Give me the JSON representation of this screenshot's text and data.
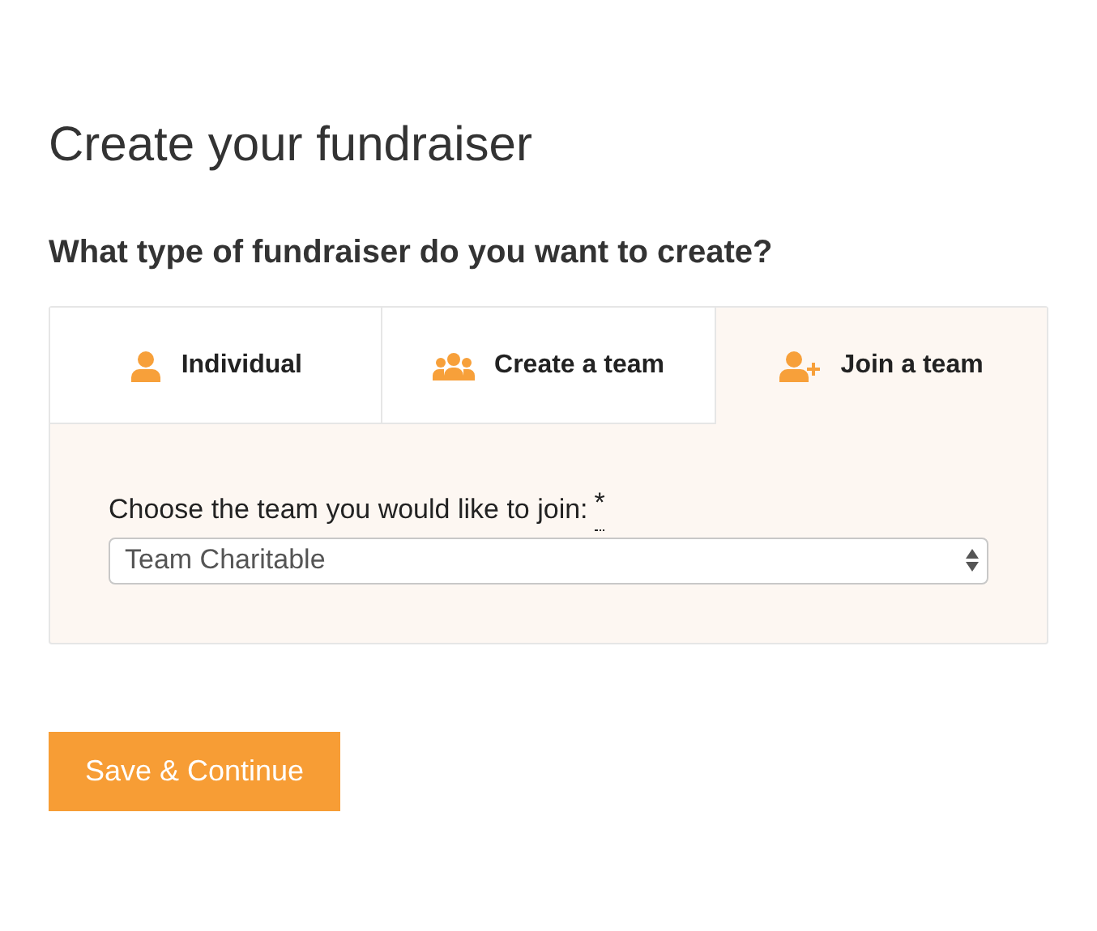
{
  "page_title": "Create your fundraiser",
  "question": "What type of fundraiser do you want to create?",
  "tabs": [
    {
      "label": "Individual",
      "kind": "person",
      "selected": false
    },
    {
      "label": "Create a team",
      "kind": "group",
      "selected": false
    },
    {
      "label": "Join a team",
      "kind": "person-plus",
      "selected": true
    }
  ],
  "field": {
    "label": "Choose the team you would like to join:",
    "required_mark": "*",
    "value": "Team Charitable"
  },
  "submit_button": "Save & Continue"
}
